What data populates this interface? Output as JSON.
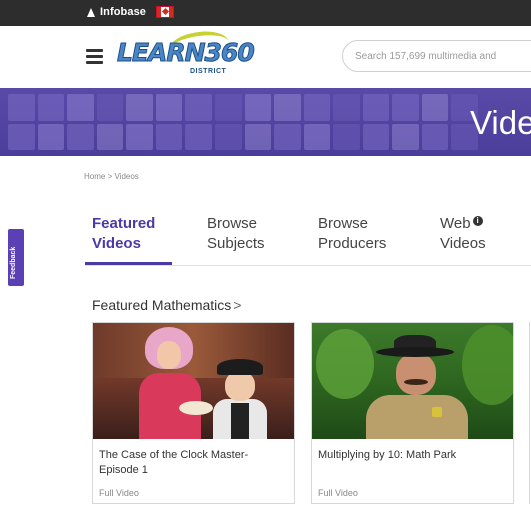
{
  "topbar": {
    "brand_name": "Infobase",
    "brand_icon": "infobase-triangle-icon",
    "flag_icon": "canada-flag-icon"
  },
  "header": {
    "menu_icon": "hamburger-menu-icon",
    "logo": {
      "text": "LEARN360",
      "sub": "DISTRICT"
    },
    "search": {
      "placeholder": "Search 157,699 multimedia and",
      "value": ""
    }
  },
  "banner": {
    "title": "Vide"
  },
  "breadcrumb": {
    "home": "Home",
    "separator": ">",
    "current": "Videos"
  },
  "feedback": {
    "label": "Feedback"
  },
  "tabs": [
    {
      "line1": "Featured",
      "line2": "Videos",
      "active": true
    },
    {
      "line1": "Browse",
      "line2": "Subjects",
      "active": false
    },
    {
      "line1": "Browse",
      "line2": "Producers",
      "active": false
    },
    {
      "line1": "Web",
      "line2": "Videos",
      "active": false,
      "icon": "info-icon"
    }
  ],
  "section": {
    "title": "Featured Mathematics",
    "chevron": ">"
  },
  "cards": [
    {
      "title": "The Case of the Clock Master- Episode 1",
      "meta": "Full Video"
    },
    {
      "title": "Multiplying by 10: Math Park",
      "meta": "Full Video"
    }
  ],
  "colors": {
    "accent": "#4b3aa5",
    "banner": "#5a4aa8",
    "topbar": "#2d2d2d",
    "feedback": "#5a3fb5"
  }
}
